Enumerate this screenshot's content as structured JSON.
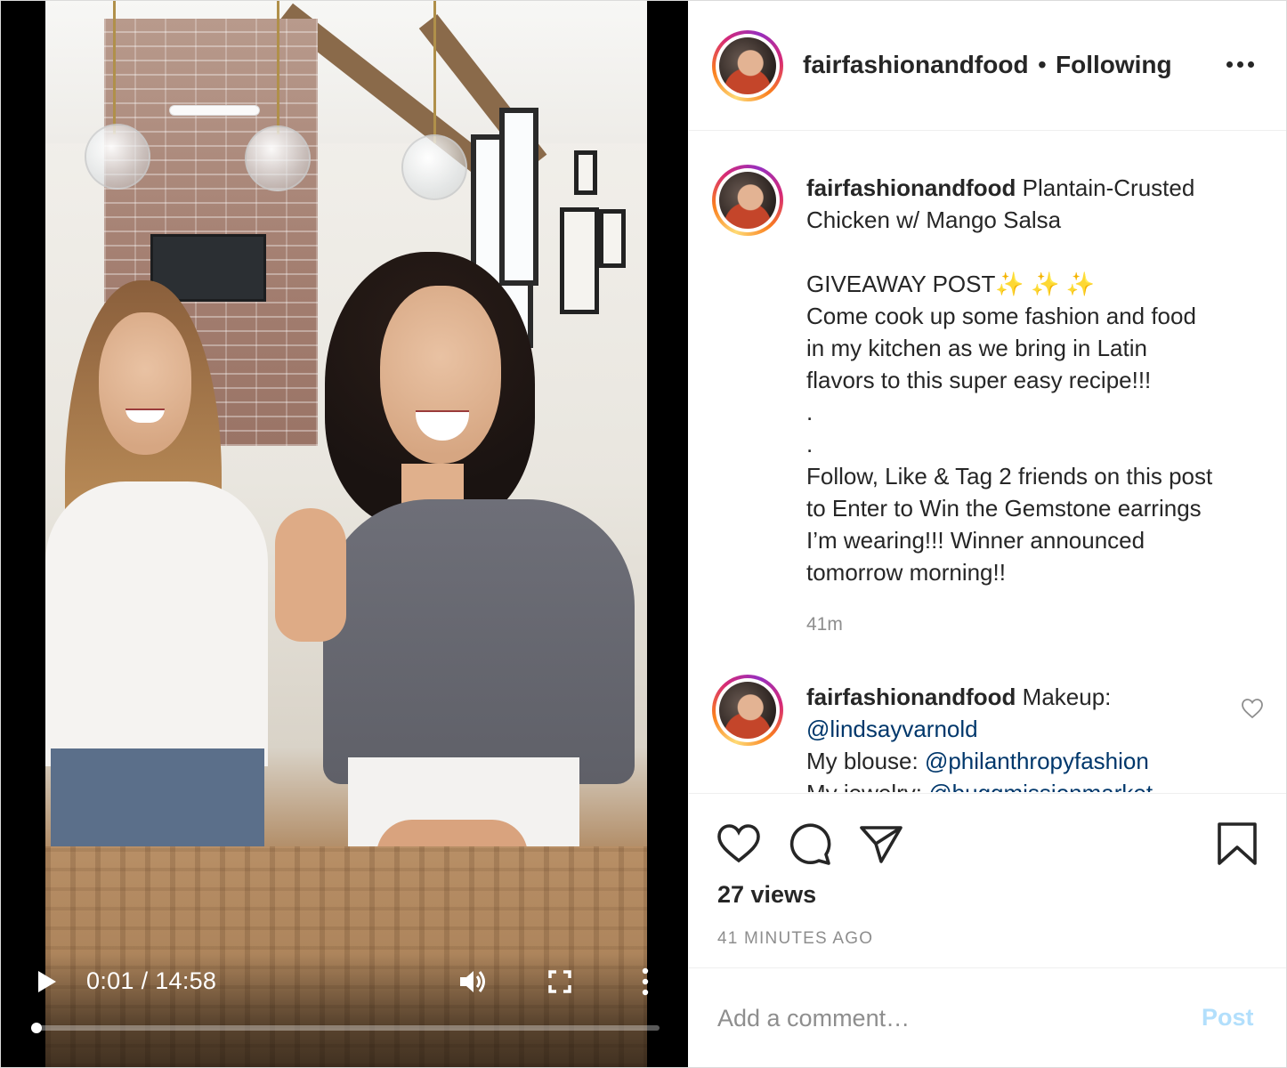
{
  "video": {
    "current_time": "0:01",
    "time_separator": "/",
    "duration": "14:58",
    "progress_fraction": 0.002,
    "controls": [
      "play-icon",
      "volume-icon",
      "fullscreen-icon",
      "more-vertical-icon"
    ]
  },
  "header": {
    "username": "fairfashionandfood",
    "separator": "•",
    "follow_status": "Following",
    "more_icon": "more-horizontal-icon"
  },
  "caption": {
    "username": "fairfashionandfood",
    "lines": [
      " Plantain-Crusted",
      "Chicken w/ Mango Salsa",
      "",
      "GIVEAWAY POST✨ ✨ ✨",
      "Come cook up some fashion and food",
      "in my kitchen as we bring in Latin",
      "flavors to this super easy recipe!!!",
      ".",
      ".",
      "Follow, Like & Tag 2 friends on this post",
      "to Enter to Win the Gemstone earrings",
      "I’m wearing!!! Winner announced",
      "tomorrow morning!!"
    ],
    "time": "41m"
  },
  "comment": {
    "username": "fairfashionandfood",
    "intro": " Makeup:",
    "mention1": "@lindsayvarnold",
    "line2_label": "My blouse: ",
    "mention2": "@philanthropyfashion",
    "line3_label": "My jewelry: ",
    "mention3": "@buggmissionmarket",
    "like_icon": "heart-outline-icon"
  },
  "actions": {
    "icons": [
      "heart-icon",
      "comment-icon",
      "share-icon",
      "bookmark-icon"
    ],
    "views": "27 views",
    "time_ago": "41 MINUTES AGO"
  },
  "comment_box": {
    "placeholder": "Add a comment…",
    "post_label": "Post"
  },
  "colors": {
    "text": "#262626",
    "secondary": "#8e8e8e",
    "mention": "#00376b",
    "post_disabled": "#b2dffc",
    "border": "#dbdbdb"
  }
}
